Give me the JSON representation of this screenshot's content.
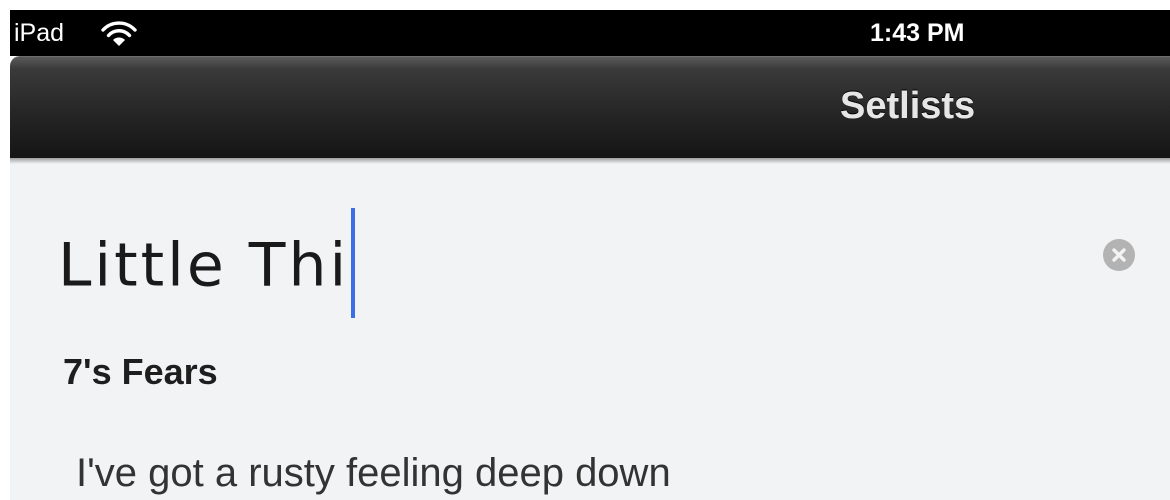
{
  "status_bar": {
    "carrier": "iPad",
    "wifi_icon": "wifi-icon",
    "time": "1:43 PM"
  },
  "nav_bar": {
    "title": "Setlists"
  },
  "editor": {
    "title_input_value": "Little Thi",
    "clear_icon": "clear-x-circle-icon",
    "song_title": "7's Fears",
    "lyric_line": "I've got a rusty feeling deep down"
  },
  "colors": {
    "status_bar_bg": "#000000",
    "nav_bar_bg": "#262626",
    "nav_title": "#e6e6e6",
    "content_bg": "#f2f3f5",
    "cursor": "#3a6fe8",
    "clear_button": "#b3b3b3"
  }
}
